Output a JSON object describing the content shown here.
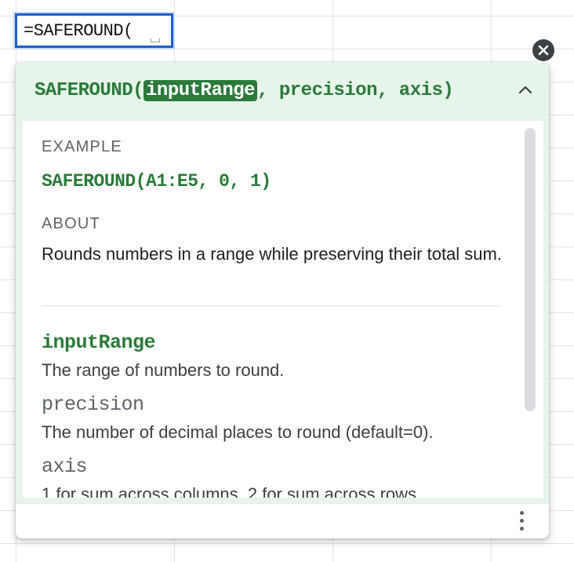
{
  "cell_editor": {
    "formula": "=SAFEROUND("
  },
  "tooltip": {
    "signature": {
      "function_name": "SAFEROUND(",
      "active_param": "inputRange",
      "rest": ", precision, axis)"
    },
    "example": {
      "heading": "EXAMPLE",
      "code": "SAFEROUND(A1:E5, 0, 1)"
    },
    "about": {
      "heading": "ABOUT",
      "text": "Rounds numbers in a range while preserving their total sum."
    },
    "parameters": [
      {
        "name": "inputRange",
        "description": "The range of numbers to round."
      },
      {
        "name": "precision",
        "description": "The number of decimal places to round (default=0)."
      },
      {
        "name": "axis",
        "description": "1 for sum across columns, 2 for sum across rows"
      }
    ]
  },
  "icons": {
    "close": "close-icon",
    "collapse": "chevron-up-icon",
    "more": "more-vertical-icon"
  },
  "colors": {
    "accent_green": "#2b7a3b",
    "header_bg": "#e6f4ea",
    "selection_blue": "#1f5fd6"
  }
}
